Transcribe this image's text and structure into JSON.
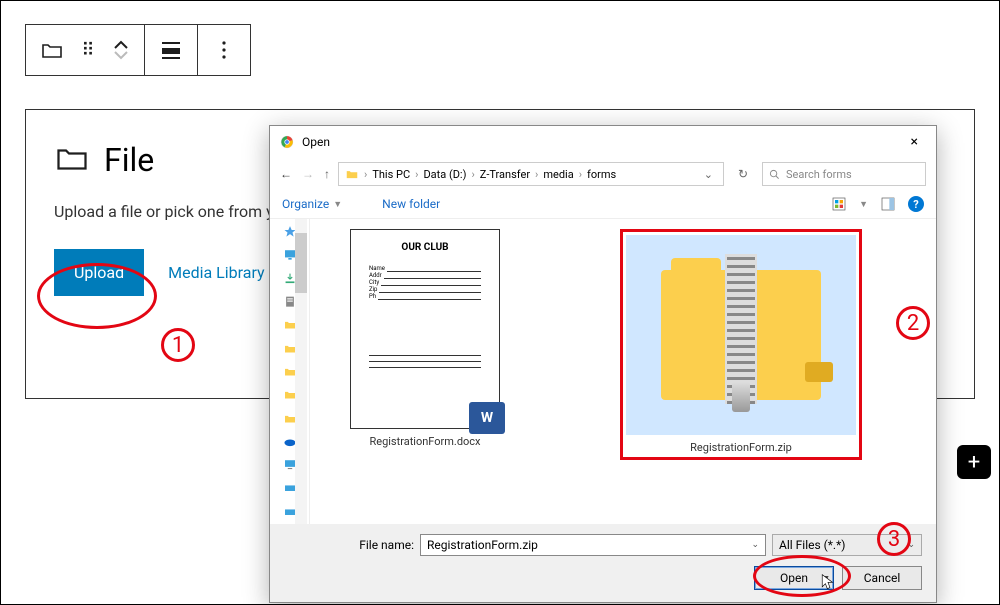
{
  "toolbar": {
    "drag_icon": "⠿"
  },
  "file_block": {
    "title": "File",
    "description": "Upload a file or pick one from your media library.",
    "upload_label": "Upload",
    "media_library_label": "Media Library"
  },
  "annotations": {
    "one": "1",
    "two": "2",
    "three": "3"
  },
  "add_button": "+",
  "dialog": {
    "title": "Open",
    "nav": {
      "back": "←",
      "fwd": "→",
      "up": "↑"
    },
    "breadcrumb": {
      "items": [
        "This PC",
        "Data (D:)",
        "Z-Transfer",
        "media",
        "forms"
      ]
    },
    "refresh_icon": "↻",
    "search": {
      "placeholder": "Search forms"
    },
    "toolbar": {
      "organize": "Organize",
      "new_folder": "New folder",
      "help": "?"
    },
    "files": {
      "doc": {
        "thumb_title": "OUR CLUB",
        "label": "RegistrationForm.docx",
        "badge": "W"
      },
      "zip": {
        "label": "RegistrationForm.zip"
      }
    },
    "bottom": {
      "file_name_label": "File name:",
      "file_name_value": "RegistrationForm.zip",
      "filter": "All Files (*.*)",
      "open": "Open",
      "cancel": "Cancel"
    },
    "close": "×"
  }
}
